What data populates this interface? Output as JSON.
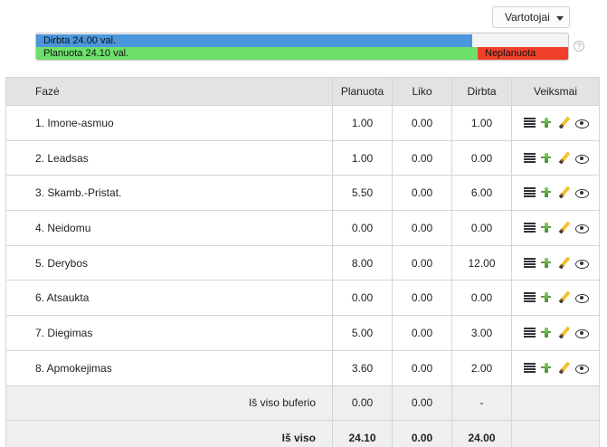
{
  "header": {
    "users_label": "Vartotojai"
  },
  "summary": {
    "worked_label": "Dirbta 24.00 val.",
    "planned_label": "Planuota 24.10 val.",
    "unplanned_label": "Neplanuota",
    "help_glyph": "?",
    "worked_fraction": 0.82,
    "planned_fraction": 0.83,
    "colors": {
      "worked": "#4b97dd",
      "planned": "#6de06b",
      "unplanned": "#f0402a"
    }
  },
  "table": {
    "columns": {
      "phase": "Fazė",
      "planned": "Planuota",
      "left": "Liko",
      "worked": "Dirbta",
      "actions": "Veiksmai"
    },
    "rows": [
      {
        "phase": "1. Imone-asmuo",
        "planned": "1.00",
        "left": "0.00",
        "worked": "1.00"
      },
      {
        "phase": "2. Leadsas",
        "planned": "1.00",
        "left": "0.00",
        "worked": "0.00"
      },
      {
        "phase": "3. Skamb.-Pristat.",
        "planned": "5.50",
        "left": "0.00",
        "worked": "6.00"
      },
      {
        "phase": "4. Neidomu",
        "planned": "0.00",
        "left": "0.00",
        "worked": "0.00"
      },
      {
        "phase": "5. Derybos",
        "planned": "8.00",
        "left": "0.00",
        "worked": "12.00"
      },
      {
        "phase": "6. Atsaukta",
        "planned": "0.00",
        "left": "0.00",
        "worked": "0.00"
      },
      {
        "phase": "7. Diegimas",
        "planned": "5.00",
        "left": "0.00",
        "worked": "3.00"
      },
      {
        "phase": "8. Apmokejimas",
        "planned": "3.60",
        "left": "0.00",
        "worked": "2.00"
      }
    ],
    "row_action_icons": [
      "list-icon",
      "tree-icon",
      "pencil-icon",
      "eye-icon"
    ],
    "buffer": {
      "label": "Iš viso buferio",
      "planned": "0.00",
      "left": "0.00",
      "worked": "-"
    },
    "total": {
      "label": "Iš viso",
      "planned": "24.10",
      "left": "0.00",
      "worked": "24.00"
    }
  }
}
